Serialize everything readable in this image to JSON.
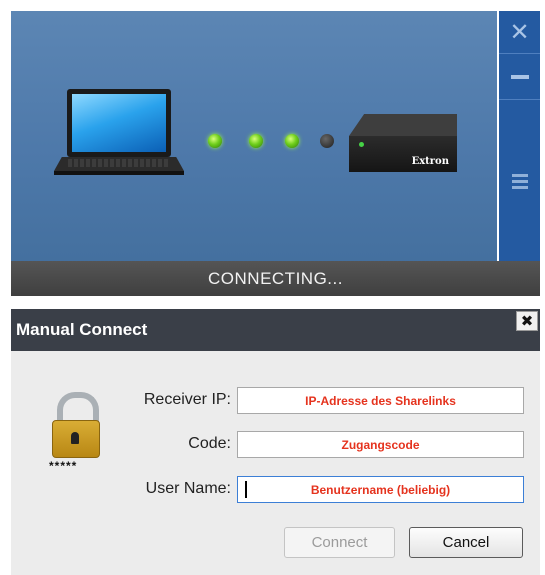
{
  "connection_panel": {
    "status_text": "CONNECTING...",
    "device_brand": "Extron",
    "progress_dots": [
      {
        "state": "active",
        "color": "#6fcf1c"
      },
      {
        "state": "active",
        "color": "#6fcf1c"
      },
      {
        "state": "active",
        "color": "#6fcf1c"
      },
      {
        "state": "inactive",
        "color": "#333333"
      }
    ],
    "side_buttons": [
      "close-icon",
      "minimize-icon",
      "menu-icon"
    ]
  },
  "dialog": {
    "title": "Manual Connect",
    "close_icon": "close-icon",
    "lock_mask": "*****",
    "fields": {
      "receiver_ip": {
        "label": "Receiver IP:",
        "value": "IP-Adresse des Sharelinks"
      },
      "code": {
        "label": "Code:",
        "value": "Zugangscode"
      },
      "user_name": {
        "label": "User Name:",
        "value": "Benutzername (beliebig)"
      }
    },
    "buttons": {
      "connect": "Connect",
      "cancel": "Cancel"
    }
  },
  "colors": {
    "panel_blue": "#4e79aa",
    "sidebar_blue": "#245aa1",
    "status_bar": "#444444",
    "dialog_header": "#3a3f48",
    "field_text_red": "#e5331e",
    "focus_border": "#3c7fd6"
  }
}
